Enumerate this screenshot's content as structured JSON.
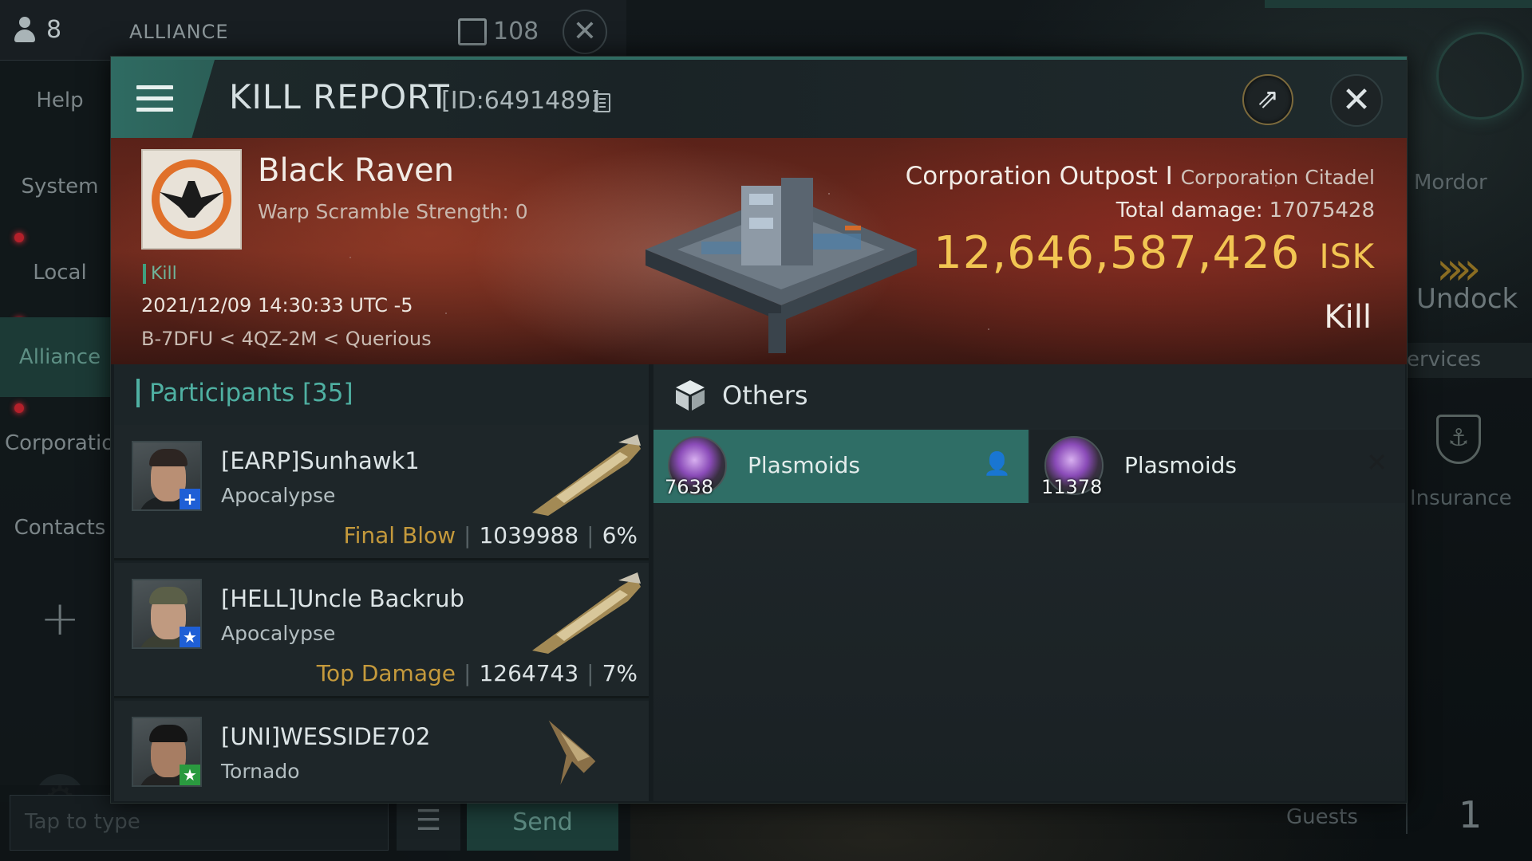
{
  "background": {
    "pilot_count": "8",
    "channel_title": "ALLIANCE",
    "message_count": "108",
    "nav": {
      "help": "Help",
      "system": "System",
      "local": "Local",
      "alliance": "Alliance",
      "corporation": "Corporation",
      "contacts": "Contacts"
    },
    "chat_input_placeholder": "Tap to type",
    "send_label": "Send",
    "station_name": "Mordor",
    "undock_label": "Undock",
    "services_label": "ervices",
    "insurance_label": "Insurance",
    "guests_label": "Guests",
    "guests_count": "1"
  },
  "modal": {
    "title": "KILL REPORT",
    "report_id": "[ID:6491489]",
    "victim": {
      "name": "Black Raven",
      "scram": "Warp Scramble Strength: 0",
      "tag": "Kill",
      "time": "2021/12/09 14:30:33 UTC -5",
      "location": "B-7DFU < 4QZ-2M < Querious"
    },
    "ship": {
      "name": "Corporation Outpost I",
      "type": "Corporation Citadel",
      "total_damage_label": "Total damage:",
      "total_damage": "17075428",
      "isk_value": "12,646,587,426",
      "isk_unit": "ISK",
      "result": "Kill"
    },
    "participants": {
      "title": "Participants [35]",
      "list": [
        {
          "name": "[EARP]Sunhawk1",
          "ship": "Apocalypse",
          "role": "Final Blow",
          "damage": "1039988",
          "percent": "6%",
          "badge": "+",
          "badge_color": "#1f5fd6"
        },
        {
          "name": "[HELL]Uncle Backrub",
          "ship": "Apocalypse",
          "role": "Top Damage",
          "damage": "1264743",
          "percent": "7%",
          "badge": "★",
          "badge_color": "#1f5fd6"
        },
        {
          "name": "[UNI]WESSIDE702",
          "ship": "Tornado",
          "role": "",
          "damage": "",
          "percent": "",
          "badge": "★",
          "badge_color": "#2a9a3f"
        }
      ]
    },
    "others": {
      "title": "Others",
      "items": [
        {
          "name": "Plasmoids",
          "qty": "7638",
          "state": "dropped"
        },
        {
          "name": "Plasmoids",
          "qty": "11378",
          "state": "destroyed"
        }
      ]
    }
  },
  "colors": {
    "accent_teal": "#2f6e66",
    "isk_gold": "#f2c552",
    "role_gold": "#c59a3c"
  },
  "icons": [
    "user-icon",
    "chat-icon",
    "close-icon",
    "plus-icon",
    "gear-icon",
    "undock-arrows-icon",
    "insurance-icon",
    "menu-icon",
    "copy-icon",
    "share-icon",
    "cube-icon",
    "person-icon"
  ]
}
